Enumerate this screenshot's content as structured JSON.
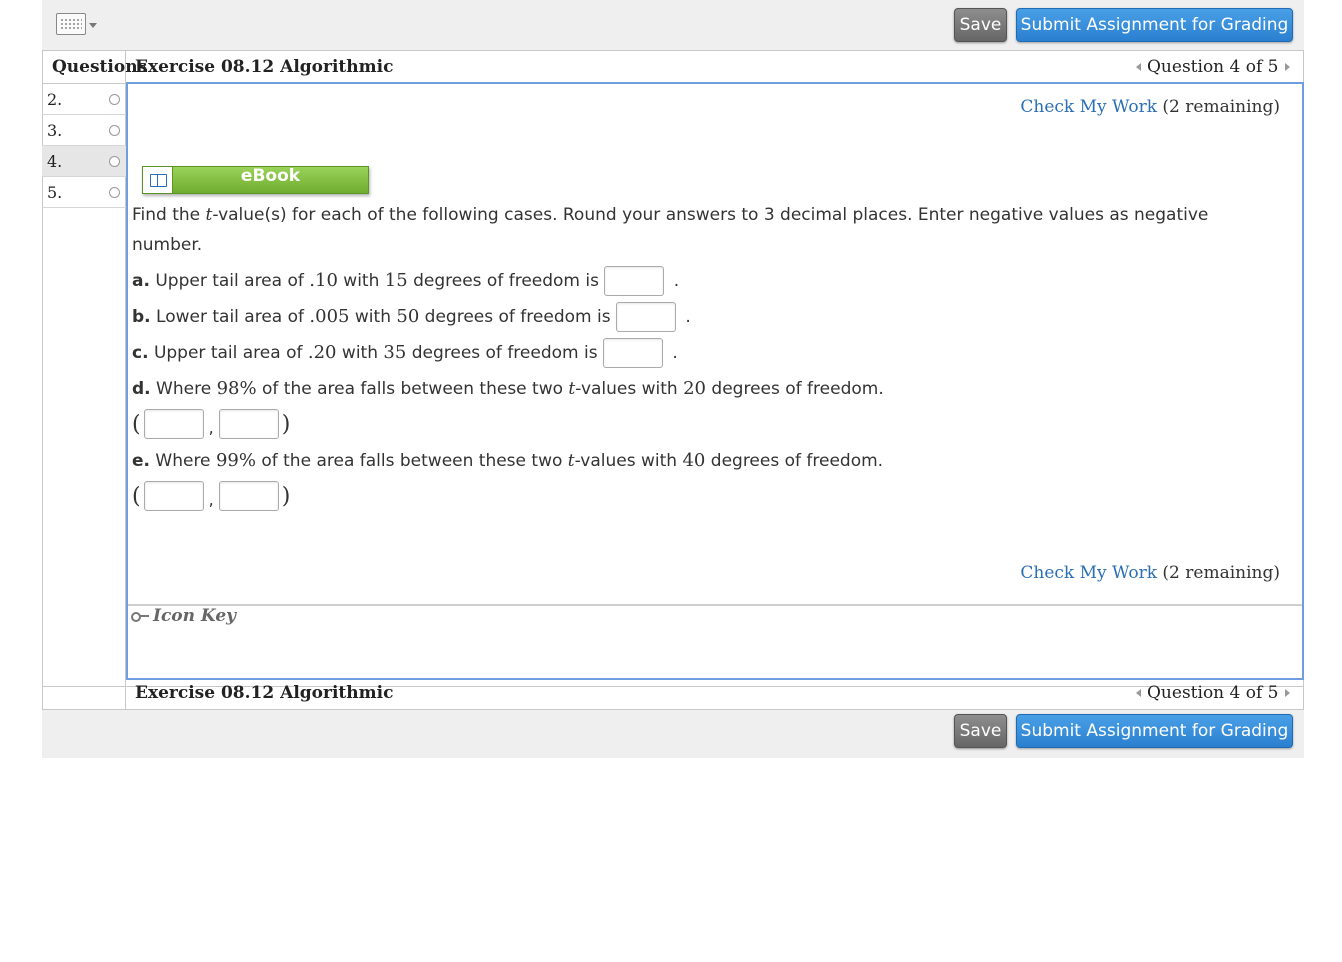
{
  "toolbar": {
    "save_label": "Save",
    "submit_label": "Submit Assignment for Grading"
  },
  "sidebar": {
    "header": "Questions",
    "items": [
      {
        "label": "2."
      },
      {
        "label": "3."
      },
      {
        "label": "4."
      },
      {
        "label": "5."
      }
    ],
    "active_index": 2
  },
  "header": {
    "title": "Exercise 08.12 Algorithmic",
    "question_nav": "Question 4 of 5"
  },
  "check_work": {
    "link_label": "Check My Work",
    "remaining": "(2 remaining)"
  },
  "ebook": {
    "label": "eBook"
  },
  "question": {
    "intro_part1": "Find the ",
    "intro_var": "t",
    "intro_part2": "-value(s) for each of the following cases. Round your answers to 3 decimal places. Enter negative values as negative",
    "intro_line2": "number.",
    "a": {
      "label": "a.",
      "text1": " Upper tail area of ",
      "area": ".10",
      "text2": " with ",
      "df": "15",
      "text3": " degrees of freedom is ",
      "end": "."
    },
    "b": {
      "label": "b.",
      "text1": " Lower tail area of ",
      "area": ".005",
      "text2": " with ",
      "df": "50",
      "text3": " degrees of freedom is ",
      "end": "."
    },
    "c": {
      "label": "c.",
      "text1": " Upper tail area of ",
      "area": ".20",
      "text2": " with ",
      "df": "35",
      "text3": " degrees of freedom is ",
      "end": "."
    },
    "d": {
      "label": "d.",
      "text1": " Where ",
      "pct": "98%",
      "text2": " of the area falls between these two ",
      "var": "t",
      "text3": "-values with ",
      "df": "20",
      "text4": " degrees of freedom."
    },
    "e": {
      "label": "e.",
      "text1": " Where ",
      "pct": "99%",
      "text2": " of the area falls between these two ",
      "var": "t",
      "text3": "-values with ",
      "df": "40",
      "text4": " degrees of freedom."
    },
    "pair_open": "(",
    "pair_comma": ",",
    "pair_close": ")"
  },
  "icon_key": {
    "label": "Icon Key"
  },
  "colors": {
    "accent_blue": "#2a7fcf",
    "link_blue": "#2a6fb5",
    "ebook_green": "#7dbd3a",
    "panel_border": "#6f9ee0"
  }
}
